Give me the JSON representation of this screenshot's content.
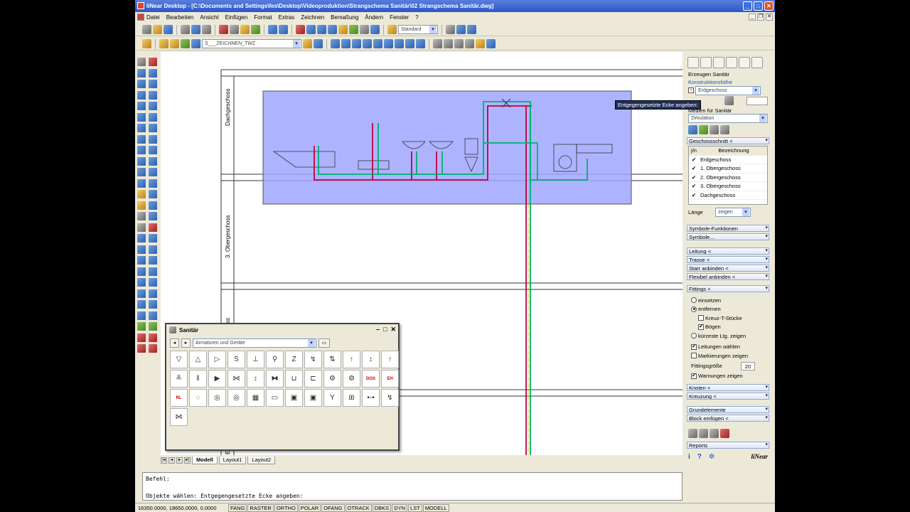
{
  "window": {
    "title": "liNear Desktop - [C:\\Documents and Settings\\fes\\Desktop\\Videoproduktion\\Strangschema Sanitär\\02 Strangschema Sanitär.dwg]"
  },
  "menu": [
    "Datei",
    "Bearbeiten",
    "Ansicht",
    "Einfügen",
    "Format",
    "Extras",
    "Zeichnen",
    "Bemaßung",
    "Ändern",
    "Fenster",
    "?"
  ],
  "toolbar": {
    "style_combo": "Standard",
    "layer_combo": "S___ZEICHNEN_TWZ"
  },
  "drawing": {
    "floor_labels": [
      "Dachgeschoss",
      "3. Obergeschoss",
      "ss",
      "E"
    ]
  },
  "tooltip": "Entgegengesetzte Ecke angeben:",
  "layout_tabs": [
    "Modell",
    "Layout1",
    "Layout2"
  ],
  "command": {
    "line1": "Befehl:",
    "line2": "Objekte wählen: Entgegengesetzte Ecke angeben:"
  },
  "status": {
    "coords": "16350.0000, 18650.0000, 0.0000",
    "buttons": [
      "FANG",
      "RASTER",
      "ORTHO",
      "POLAR",
      "OFANG",
      "OTRACK",
      "DBKS",
      "DYN",
      "LST",
      "MODELL"
    ]
  },
  "panel": {
    "header": "Erzeugen Sanitär",
    "konstruktionshoehe": "Konstruktionshöhe",
    "floor_combo": "Erdgeschoss",
    "medien_label": "Medien für Sanitär",
    "medium_combo": "Zirkulation",
    "geschossschnitt": "Geschossschnitt <",
    "table_header": {
      "col1": "j/n",
      "col2": "Bezeichnung"
    },
    "floors": [
      "Erdgeschoss",
      "1. Obergeschoss",
      "2. Obergeschoss",
      "3. Obergeschoss",
      "Dachgeschoss"
    ],
    "laenge_label": "Länge",
    "laenge_value": "zeigen",
    "symbole_funktionen": "Symbole-Funktionen",
    "symbole": "Symbole...",
    "leitung": "Leitung <",
    "trasse": "Trasse <",
    "starr": "Starr anbinden <",
    "flexibel": "Flexibel anbinden <",
    "fittings": "Fittings <",
    "einsetzen": "einsetzen",
    "entfernen": "entfernen",
    "kreuz": "Kreuz-T-Stücke",
    "boegen": "Bögen",
    "kuerzeste": "kürzeste Ltg. zeigen",
    "leitungen_waehlen": "Leitungen wählen",
    "markierungen": "Markierungen zeigen",
    "fittingsgroesse_label": "Fittingsgröße",
    "fittingsgroesse_value": "20",
    "warnungen": "Warnungen zeigen",
    "knoten": "Knoten <",
    "kreuzung": "Kreuzung <",
    "grundelemente": "Grundelemente",
    "block": "Block einfügen <",
    "reports": "Reports",
    "logo": "liNear"
  },
  "sanitaer_window": {
    "title": "Sanitär",
    "category": "Armaturen und Geräte",
    "symbols": [
      "▽",
      "△",
      "▷",
      "S",
      "⊥",
      "⚲",
      "Z",
      "↯",
      "⇅",
      "↑",
      "↕",
      "↑",
      "≚",
      "‖",
      "▶",
      "⋈",
      "↕",
      "⧓",
      "⊔",
      "⊏",
      "⚙",
      "⚙",
      "DOS",
      "EH",
      "RL",
      "◌",
      "◎",
      "◎",
      "▦",
      "▭",
      "▣",
      "▣",
      "Y",
      "⊞",
      "•-•",
      "↯",
      "⋈"
    ]
  }
}
